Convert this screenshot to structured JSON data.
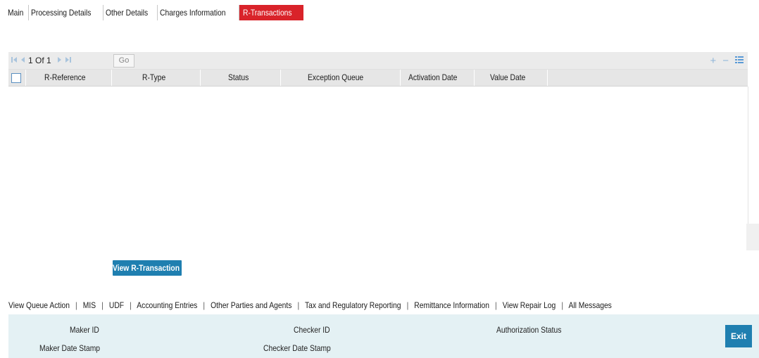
{
  "tabs": [
    "Main",
    "Processing Details",
    "Other Details",
    "Charges Information",
    "R-Transactions"
  ],
  "active_tab": "R-Transactions",
  "grid": {
    "pager_text": "1 Of 1",
    "go_label": "Go",
    "columns": [
      "R-Reference",
      "R-Type",
      "Status",
      "Exception Queue",
      "Activation Date",
      "Value Date"
    ],
    "rows": []
  },
  "view_button": "View R-Transaction",
  "links": [
    "View Queue Action",
    "MIS",
    "UDF",
    "Accounting Entries",
    "Other Parties and Agents",
    "Tax and Regulatory Reporting",
    "Remittance Information",
    "View Repair Log",
    "All Messages"
  ],
  "link_separator": "|",
  "footer": {
    "maker_id": "Maker ID",
    "maker_date_stamp": "Maker Date Stamp",
    "checker_id": "Checker ID",
    "checker_date_stamp": "Checker Date Stamp",
    "authorization_status": "Authorization Status",
    "exit_label": "Exit"
  },
  "colors": {
    "active_tab": "#d9232a",
    "button": "#1f7fb0",
    "footer_bg": "#e4f1f4"
  },
  "icons": {
    "first_page": "first-page-icon",
    "prev_page": "prev-page-icon",
    "next_page": "next-page-icon",
    "last_page": "last-page-icon",
    "add_row": "plus-icon",
    "delete_row": "minus-icon",
    "single_view": "list-view-icon"
  }
}
